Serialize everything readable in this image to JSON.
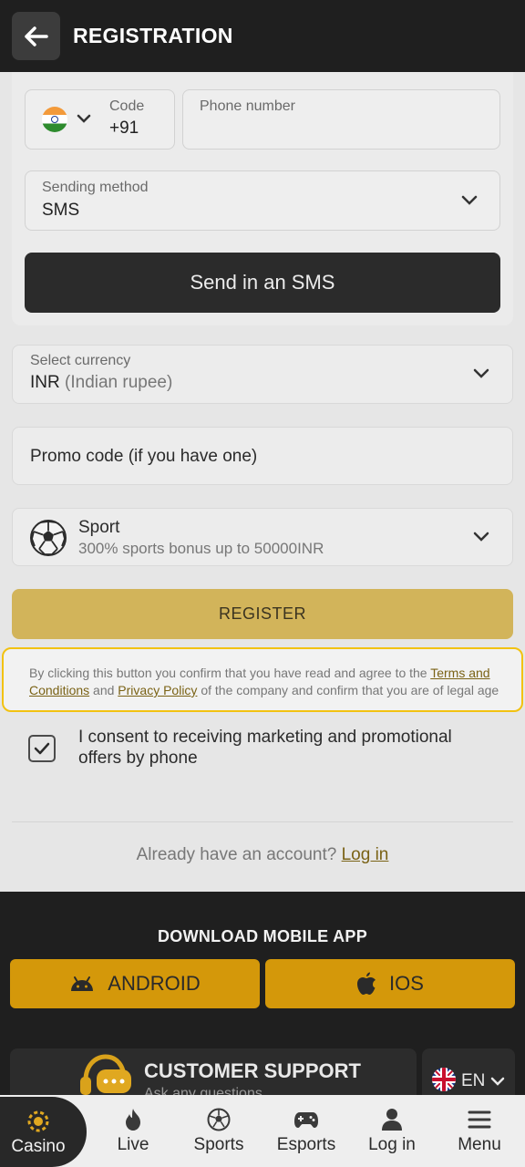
{
  "header": {
    "title": "REGISTRATION"
  },
  "phone": {
    "code_label": "Code",
    "code_value": "+91",
    "number_placeholder": "Phone number"
  },
  "sending_method": {
    "label": "Sending method",
    "value": "SMS"
  },
  "send_button": "Send in an SMS",
  "currency": {
    "label": "Select currency",
    "code": "INR",
    "name": "(Indian rupee)"
  },
  "promo": {
    "placeholder": "Promo code (if you have one)"
  },
  "bonus": {
    "title": "Sport",
    "subtitle": "300% sports bonus up to 50000INR"
  },
  "register_button": "REGISTER",
  "terms": {
    "part1": "By clicking this button you confirm that you have read and agree to the ",
    "link1": "Terms and Conditions",
    "part2": " and ",
    "link2": "Privacy Policy",
    "part3": " of the company and confirm that you are of legal age"
  },
  "consent": {
    "text": "I consent to receiving marketing and promotional offers by phone",
    "checked": true
  },
  "login_prompt": {
    "text": "Already have an account? ",
    "link": "Log in"
  },
  "download": {
    "title": "DOWNLOAD MOBILE APP",
    "android": "ANDROID",
    "ios": "IOS"
  },
  "support": {
    "title": "CUSTOMER SUPPORT",
    "subtitle": "Ask any questions"
  },
  "language": {
    "code": "EN"
  },
  "nav": {
    "casino": "Casino",
    "live": "Live",
    "sports": "Sports",
    "esports": "Esports",
    "login": "Log in",
    "menu": "Menu"
  },
  "colors": {
    "accent": "#d4980a",
    "register": "#d2b45a",
    "highlight_border": "#f2c211",
    "dark": "#1f1f1f"
  }
}
